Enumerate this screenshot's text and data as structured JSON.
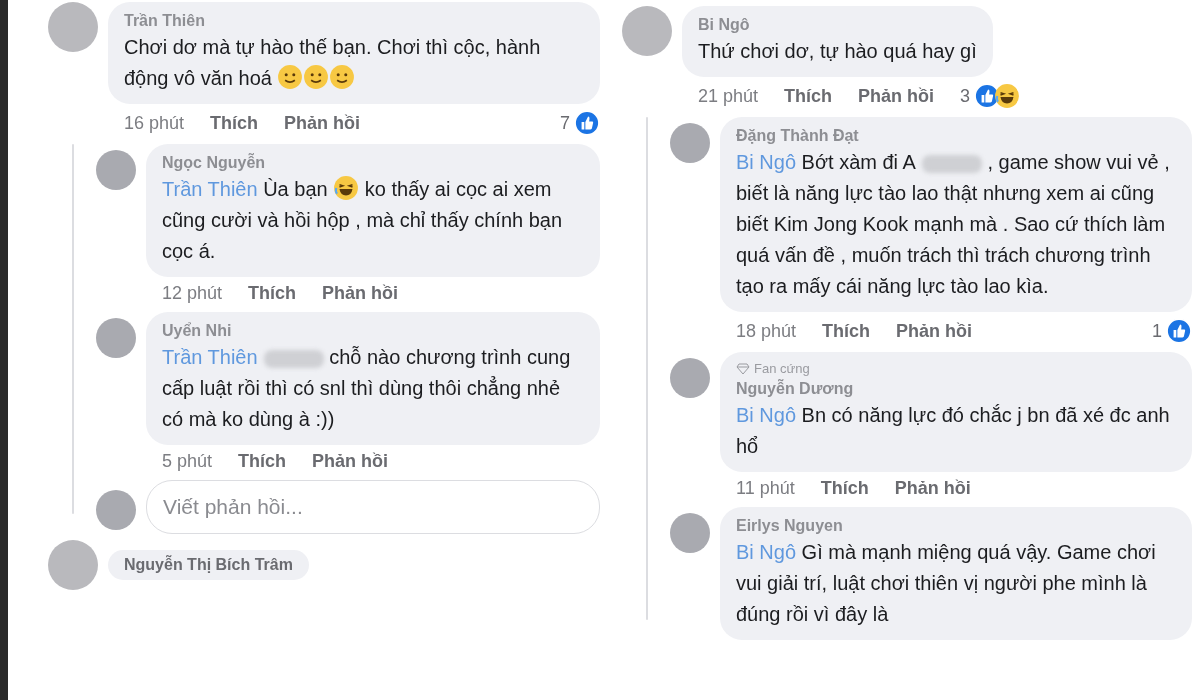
{
  "panels": [
    {
      "comments": [
        {
          "author": "Trần Thiên",
          "segments": [
            {
              "kind": "text",
              "text": "Chơi dơ mà tự hào thế bạn. Chơi thì cộc, hành động vô văn hoá "
            },
            {
              "kind": "smile-emoji"
            },
            {
              "kind": "smile-emoji"
            },
            {
              "kind": "smile-emoji"
            }
          ],
          "time": "16 phút",
          "like": "Thích",
          "reply": "Phản hồi",
          "reactions": {
            "count": "7",
            "icons": [
              {
                "kind": "like"
              }
            ]
          },
          "replies": [
            {
              "author": "Ngọc Nguyễn",
              "segments": [
                {
                  "kind": "mention",
                  "text": "Trần Thiên"
                },
                {
                  "kind": "text",
                  "text": " Ùa bạn "
                },
                {
                  "kind": "laugh-emoji"
                },
                {
                  "kind": "text",
                  "text": " ko thấy ai cọc ai xem cũng cười và hồi hộp , mà chỉ thấy chính bạn cọc á."
                }
              ],
              "time": "12 phút",
              "like": "Thích",
              "reply": "Phản hồi"
            },
            {
              "author": "Uyển Nhi",
              "segments": [
                {
                  "kind": "mention",
                  "text": "Trần Thiên"
                },
                {
                  "kind": "redacted"
                },
                {
                  "kind": "text",
                  "text": " chỗ nào chương trình cung cấp luật rồi thì có snl thì dùng thôi chẳng nhẻ có mà ko dùng à :))"
                }
              ],
              "time": "5 phút",
              "like": "Thích",
              "reply": "Phản hồi"
            }
          ],
          "reply_field": {
            "placeholder": "Viết phản hồi..."
          }
        }
      ],
      "next_author": "Nguyễn Thị Bích Trâm"
    },
    {
      "comments": [
        {
          "author": "Bi Ngô",
          "segments": [
            {
              "kind": "text",
              "text": "Thứ chơi dơ, tự hào quá hay gì"
            }
          ],
          "time": "21 phút",
          "like": "Thích",
          "reply": "Phản hồi",
          "reactions": {
            "count": "3",
            "icons": [
              {
                "kind": "like"
              },
              {
                "kind": "haha"
              }
            ]
          },
          "replies": [
            {
              "author": "Đặng Thành Đạt",
              "segments": [
                {
                  "kind": "mention",
                  "text": "Bi Ngô"
                },
                {
                  "kind": "text",
                  "text": " Bớt xàm đi A"
                },
                {
                  "kind": "redacted"
                },
                {
                  "kind": "text",
                  "text": " , game show vui vẻ , biết là năng lực tào lao thật nhưng xem ai cũng biết Kim Jong Kook mạnh mà . Sao cứ thích làm quá vấn đề , muốn trách thì trách chương trình tạo ra mấy cái năng lực tào lao kìa."
                }
              ],
              "time": "18 phút",
              "like": "Thích",
              "reply": "Phản hồi",
              "reactions": {
                "count": "1",
                "icons": [
                  {
                    "kind": "like"
                  }
                ]
              }
            },
            {
              "author": "Nguyễn Dương",
              "badge": "Fan cứng",
              "segments": [
                {
                  "kind": "mention",
                  "text": "Bi Ngô"
                },
                {
                  "kind": "text",
                  "text": " Bn có năng lực đó chắc j bn đã xé đc anh hổ"
                }
              ],
              "time": "11 phút",
              "like": "Thích",
              "reply": "Phản hồi"
            },
            {
              "author": "Eirlys Nguyen",
              "segments": [
                {
                  "kind": "mention",
                  "text": "Bi Ngô"
                },
                {
                  "kind": "text",
                  "text": " Gì mà mạnh miệng quá vậy. Game chơi vui giải trí, luật chơi thiên vị người phe mình là đúng rồi vì đây là"
                }
              ]
            }
          ]
        }
      ]
    }
  ]
}
